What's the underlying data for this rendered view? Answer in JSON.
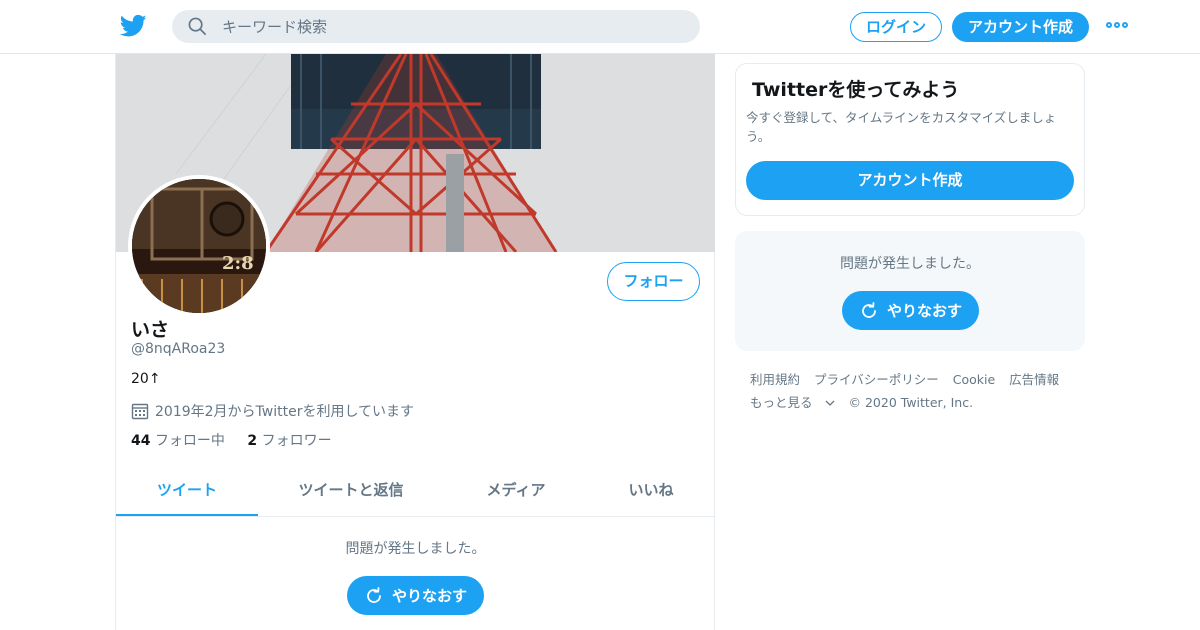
{
  "header": {
    "search_placeholder": "キーワード検索",
    "login_label": "ログイン",
    "signup_label": "アカウント作成",
    "brand_color": "#1da1f2"
  },
  "profile": {
    "name": "いさ",
    "handle": "@8nqARoa23",
    "bio": "20↑",
    "joined": "2019年2月からTwitterを利用しています",
    "following_count": "44",
    "following_label": "フォロー中",
    "followers_count": "2",
    "followers_label": "フォロワー",
    "follow_label": "フォロー",
    "avatar_text": "2:8"
  },
  "tabs": [
    {
      "label": "ツイート",
      "active": true
    },
    {
      "label": "ツイートと返信",
      "active": false
    },
    {
      "label": "メディア",
      "active": false
    },
    {
      "label": "いいね",
      "active": false
    }
  ],
  "timeline": {
    "error_text": "問題が発生しました。",
    "retry_label": "やりなおす"
  },
  "sidebar": {
    "card_title": "Twitterを使ってみよう",
    "card_desc": "今すぐ登録して、タイムラインをカスタマイズしましょう。",
    "card_button": "アカウント作成",
    "error_text": "問題が発生しました。",
    "retry_label": "やりなおす",
    "footer_links": [
      "利用規約",
      "プライバシーポリシー",
      "Cookie",
      "広告情報"
    ],
    "more_label": "もっと見る",
    "copyright": "© 2020 Twitter, Inc."
  }
}
